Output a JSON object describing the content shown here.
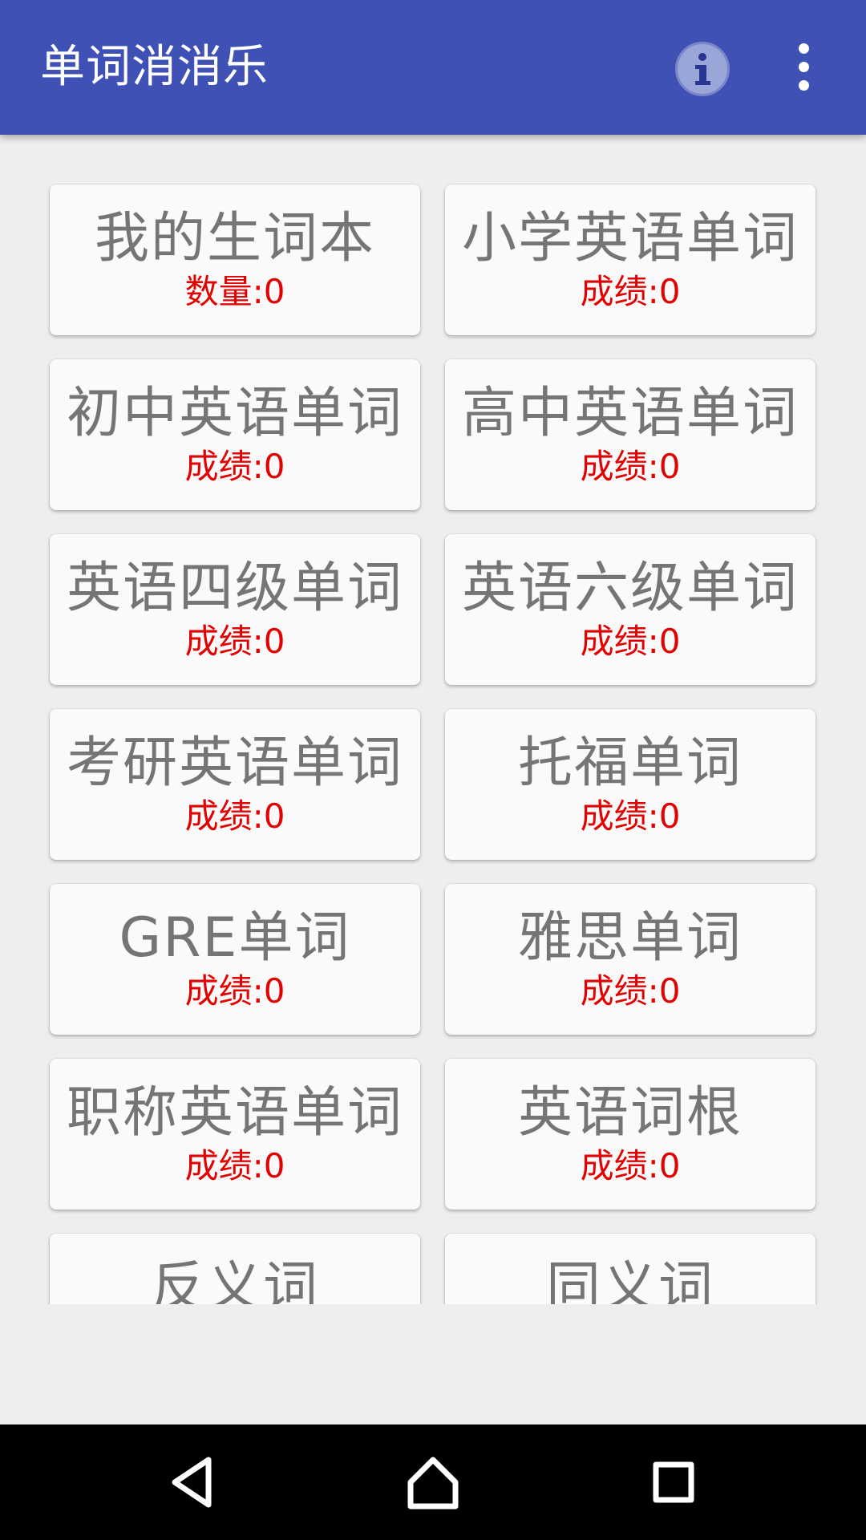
{
  "app": {
    "title": "单词消消乐"
  },
  "toolbar": {
    "info_icon": "info-icon",
    "overflow_icon": "more-vert-icon"
  },
  "tiles": [
    {
      "title": "我的生词本",
      "stat": "数量:0"
    },
    {
      "title": "小学英语单词",
      "stat": "成绩:0"
    },
    {
      "title": "初中英语单词",
      "stat": "成绩:0"
    },
    {
      "title": "高中英语单词",
      "stat": "成绩:0"
    },
    {
      "title": "英语四级单词",
      "stat": "成绩:0"
    },
    {
      "title": "英语六级单词",
      "stat": "成绩:0"
    },
    {
      "title": "考研英语单词",
      "stat": "成绩:0"
    },
    {
      "title": "托福单词",
      "stat": "成绩:0"
    },
    {
      "title": "GRE单词",
      "stat": "成绩:0"
    },
    {
      "title": "雅思单词",
      "stat": "成绩:0"
    },
    {
      "title": "职称英语单词",
      "stat": "成绩:0"
    },
    {
      "title": "英语词根",
      "stat": "成绩:0"
    },
    {
      "title": "反义词",
      "stat": ""
    },
    {
      "title": "同义词",
      "stat": ""
    }
  ],
  "colors": {
    "appbar": "#3f51b5",
    "tile_title": "#757575",
    "tile_stat": "#e30000",
    "background": "#eeeeee"
  },
  "navbar": {
    "back_icon": "back-triangle-icon",
    "home_icon": "home-icon",
    "recents_icon": "recents-square-icon"
  }
}
